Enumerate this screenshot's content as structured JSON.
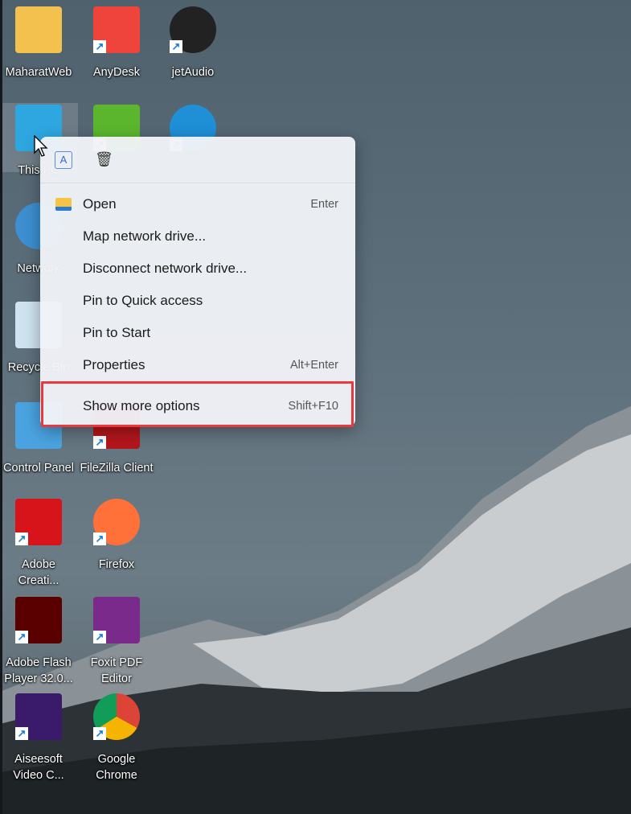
{
  "desktop": {
    "icons": [
      {
        "label": "MaharatWeb",
        "icon": "user-folder-icon",
        "color": "#f2c14e"
      },
      {
        "label": "AnyDesk",
        "icon": "anydesk-icon",
        "color": "#ef443b"
      },
      {
        "label": "jetAudio",
        "icon": "jetaudio-icon",
        "color": "#222222"
      },
      {
        "label": "This PC",
        "icon": "monitor-icon",
        "color": "#2ea6e0"
      },
      {
        "label": "",
        "icon": "camtasia-icon",
        "color": "#5bb52d"
      },
      {
        "label": "",
        "icon": "edge-icon",
        "color": "#1f8fd6"
      },
      {
        "label": "Network",
        "icon": "globe-icon",
        "color": "#3d8fd1"
      },
      {
        "label": "Recycle Bin",
        "icon": "recycle-bin-icon",
        "color": "#cfe3f0"
      },
      {
        "label": "Control Panel",
        "icon": "control-panel-icon",
        "color": "#4aa3e0"
      },
      {
        "label": "FileZilla Client",
        "icon": "filezilla-icon",
        "color": "#b3161b"
      },
      {
        "label": "Adobe Creati...",
        "icon": "adobe-cc-icon",
        "color": "#d7141a"
      },
      {
        "label": "Firefox",
        "icon": "firefox-icon",
        "color": "#ff7139"
      },
      {
        "label": "Adobe Flash Player 32.0...",
        "icon": "flash-icon",
        "color": "#5a0000"
      },
      {
        "label": "Foxit PDF Editor",
        "icon": "foxit-icon",
        "color": "#7a2a8a"
      },
      {
        "label": "Aiseesoft Video C...",
        "icon": "aiseesoft-icon",
        "color": "#3a1a6a"
      },
      {
        "label": "Google Chrome",
        "icon": "chrome-icon",
        "color": "#ffffff"
      }
    ]
  },
  "context_menu": {
    "toolbar": [
      {
        "icon": "rename-icon"
      },
      {
        "icon": "trash-icon"
      }
    ],
    "items": [
      {
        "label": "Open",
        "shortcut": "Enter",
        "icon": "folder-icon"
      },
      {
        "label": "Map network drive...",
        "shortcut": ""
      },
      {
        "label": "Disconnect network drive...",
        "shortcut": ""
      },
      {
        "label": "Pin to Quick access",
        "shortcut": ""
      },
      {
        "label": "Pin to Start",
        "shortcut": ""
      },
      {
        "label": "Properties",
        "shortcut": "Alt+Enter"
      },
      {
        "label": "Show more options",
        "shortcut": "Shift+F10",
        "highlighted": true
      }
    ],
    "highlight_color": "#e8393f"
  }
}
